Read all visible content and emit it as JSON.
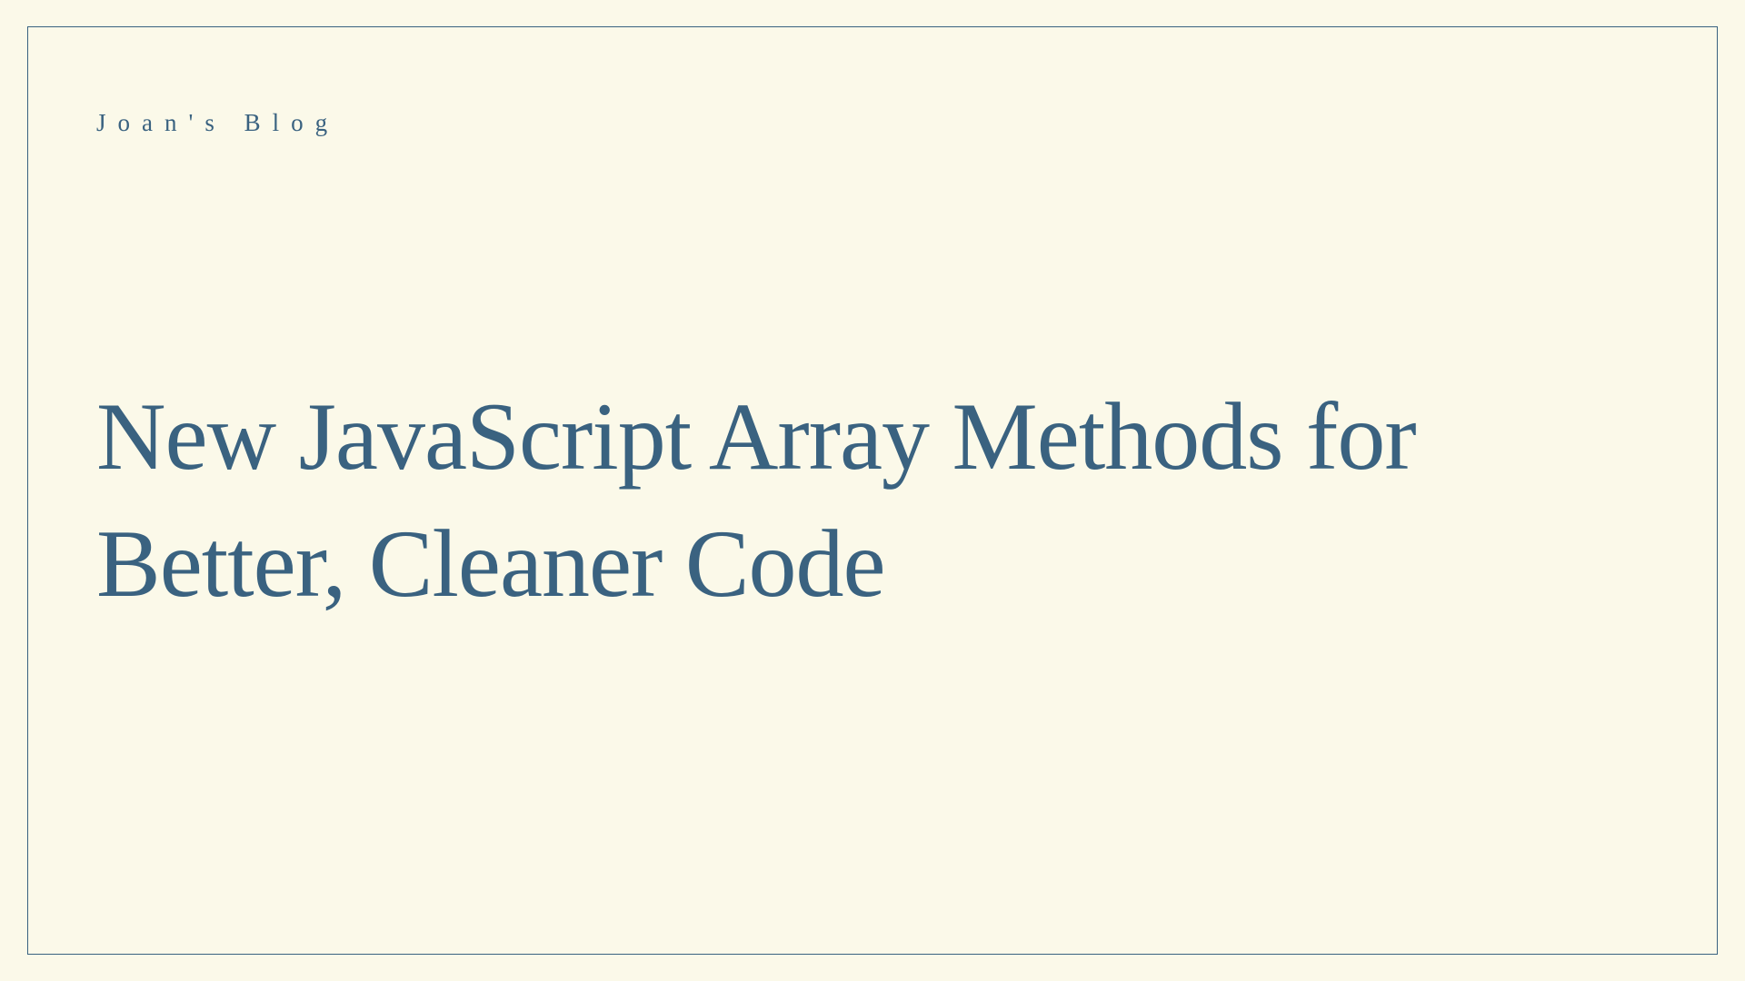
{
  "header": {
    "blog_label": "Joan's Blog"
  },
  "main": {
    "title": "New JavaScript Array Methods for Better, Cleaner Code"
  }
}
